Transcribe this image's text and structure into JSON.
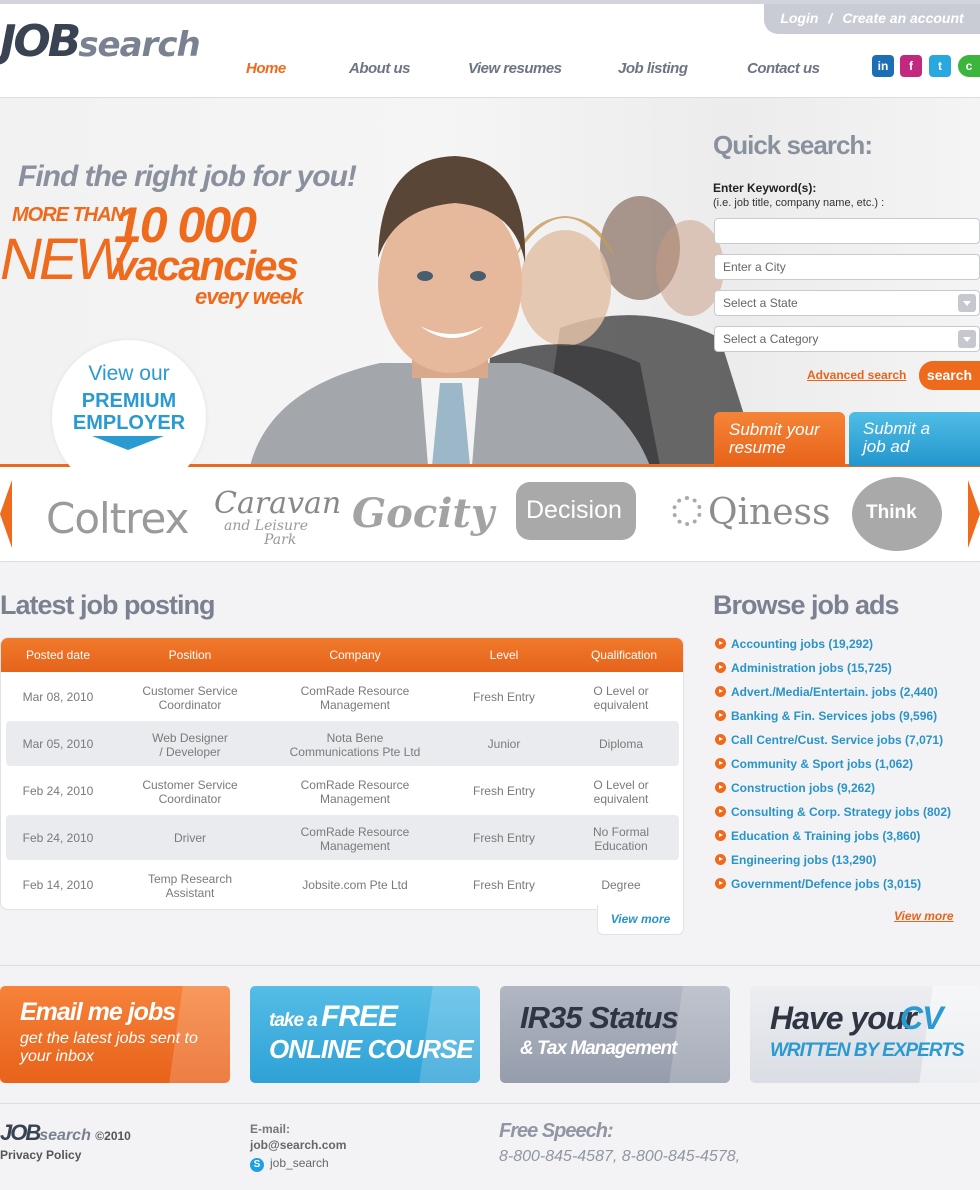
{
  "header": {
    "logo_job": "JOB",
    "logo_search": "search",
    "login": "Login",
    "separator": "/",
    "create_account": "Create an account",
    "nav": [
      "Home",
      "About us",
      "View resumes",
      "Job listing",
      "Contact us"
    ],
    "social": {
      "linkedin": "in",
      "facebook": "f",
      "twitter": "t",
      "chat": "c"
    }
  },
  "hero": {
    "tagline": "Find the right job for you!",
    "more_than": "MORE THAN",
    "new_word": "NEW",
    "count": "10 000",
    "vacancies": "vacancies",
    "every_week": "every week",
    "premium_line1": "View our",
    "premium_line2": "PREMIUM",
    "premium_line3": "EMPLOYER"
  },
  "quick_search": {
    "title": "Quick search:",
    "keyword_label": "Enter Keyword(s):",
    "keyword_hint": "(i.e. job title, company name, etc.) :",
    "keyword_value": "",
    "city_placeholder": "Enter a City",
    "state_select": "Select a State",
    "category_select": "Select a Category",
    "advanced_link": "Advanced search",
    "search_button": "search",
    "submit_resume_1": "Submit your",
    "submit_resume_2": "resume",
    "submit_ad_1": "Submit a",
    "submit_ad_2": "job ad"
  },
  "brands": [
    "Coltrex",
    "Caravan",
    "and Leisure",
    "Park",
    "Gocity",
    "Decision",
    "Qiness",
    "Think"
  ],
  "latest": {
    "title": "Latest job posting",
    "columns": [
      "Posted date",
      "Position",
      "Company",
      "Level",
      "Qualification"
    ],
    "rows": [
      {
        "date": "Mar 08, 2010",
        "pos1": "Customer Service",
        "pos2": "Coordinator",
        "co1": "ComRade Resource",
        "co2": "Management",
        "level": "Fresh Entry",
        "q1": "O Level or",
        "q2": "equivalent"
      },
      {
        "date": "Mar 05, 2010",
        "pos1": "Web Designer",
        "pos2": "/ Developer",
        "co1": "Nota Bene",
        "co2": "Communications Pte Ltd",
        "level": "Junior",
        "q1": "Diploma",
        "q2": ""
      },
      {
        "date": "Feb 24, 2010",
        "pos1": "Customer Service",
        "pos2": "Coordinator",
        "co1": "ComRade Resource",
        "co2": "Management",
        "level": "Fresh Entry",
        "q1": "O Level or",
        "q2": "equivalent"
      },
      {
        "date": "Feb 24, 2010",
        "pos1": "Driver",
        "pos2": "",
        "co1": "ComRade Resource",
        "co2": "Management",
        "level": "Fresh Entry",
        "q1": "No Formal",
        "q2": "Education"
      },
      {
        "date": "Feb 14, 2010",
        "pos1": "Temp Research",
        "pos2": "Assistant",
        "co1": "Jobsite.com Pte Ltd",
        "co2": "",
        "level": "Fresh Entry",
        "q1": "Degree",
        "q2": ""
      }
    ],
    "view_more": "View more"
  },
  "browse": {
    "title": "Browse job ads",
    "categories": [
      "Accounting jobs (19,292)",
      "Administration jobs (15,725)",
      "Advert./Media/Entertain. jobs (2,440)",
      "Banking & Fin. Services jobs (9,596)",
      "Call Centre/Cust. Service jobs (7,071)",
      "Community & Sport jobs (1,062)",
      "Construction jobs (9,262)",
      "Consulting & Corp. Strategy jobs (802)",
      "Education & Training jobs (3,860)",
      "Engineering jobs (13,290)",
      "Government/Defence jobs (3,015)"
    ],
    "view_more": "View more"
  },
  "promos": {
    "email_1": "Email me jobs",
    "email_2": "get the latest jobs sent to",
    "email_3": "your inbox",
    "course_1": "take a",
    "course_free": "FREE",
    "course_2": "ONLINE COURSE",
    "ir35_1": "IR35 Status",
    "ir35_2": "& Tax Management",
    "cv_1": "Have your",
    "cv_cv": "CV",
    "cv_2": "WRITTEN BY EXPERTS"
  },
  "footer": {
    "logo_job": "JOB",
    "logo_search": "search",
    "year": "©2010",
    "privacy": "Privacy Policy",
    "email_label": "E-mail:",
    "email": "job@search.com",
    "skype": "job_search",
    "free_speech": "Free Speech:",
    "phones": "8-800-845-4587,  8-800-845-4578,"
  },
  "colors": {
    "orange": "#ee6a1c",
    "blue": "#2a93c7",
    "slate": "#7b8190"
  }
}
